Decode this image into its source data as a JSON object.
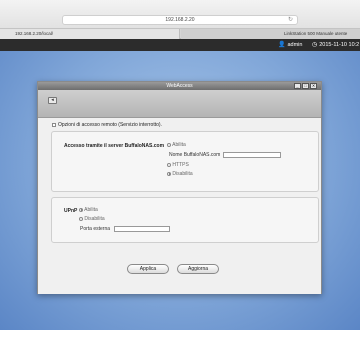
{
  "browser": {
    "url": "192.168.2.20",
    "tabs": [
      {
        "label": "192.168.2.20/local/"
      },
      {
        "label": "LinkStation 500 Manuale utente"
      }
    ]
  },
  "nas_header": {
    "user": "admin",
    "datetime": "2015-11-10 10:2"
  },
  "window": {
    "title": "WebAccess",
    "controls": [
      "_",
      "□",
      "✕"
    ],
    "back_icon": "back-arrow-icon",
    "remote_option": {
      "label": "Opzioni di accesso remoto (Servizio interrotto).",
      "checked": false
    },
    "buffalonas": {
      "heading": "Accesso tramite il server BuffaloNAS.com",
      "enable_label": "Abilita",
      "enable_selected": false,
      "name_label": "Nome BuffaloNAS.com",
      "name_value": "",
      "https_label": "HTTPS",
      "https_selected": false,
      "disable_label": "Disabilita",
      "disable_selected": true
    },
    "upnp": {
      "heading": "UPnP",
      "enable_label": "Abilita",
      "enable_selected": true,
      "disable_label": "Disabilita",
      "disable_selected": false,
      "port_label": "Porta esterna",
      "port_value": ""
    },
    "buttons": {
      "apply": "Applica",
      "refresh": "Aggiorna"
    }
  }
}
